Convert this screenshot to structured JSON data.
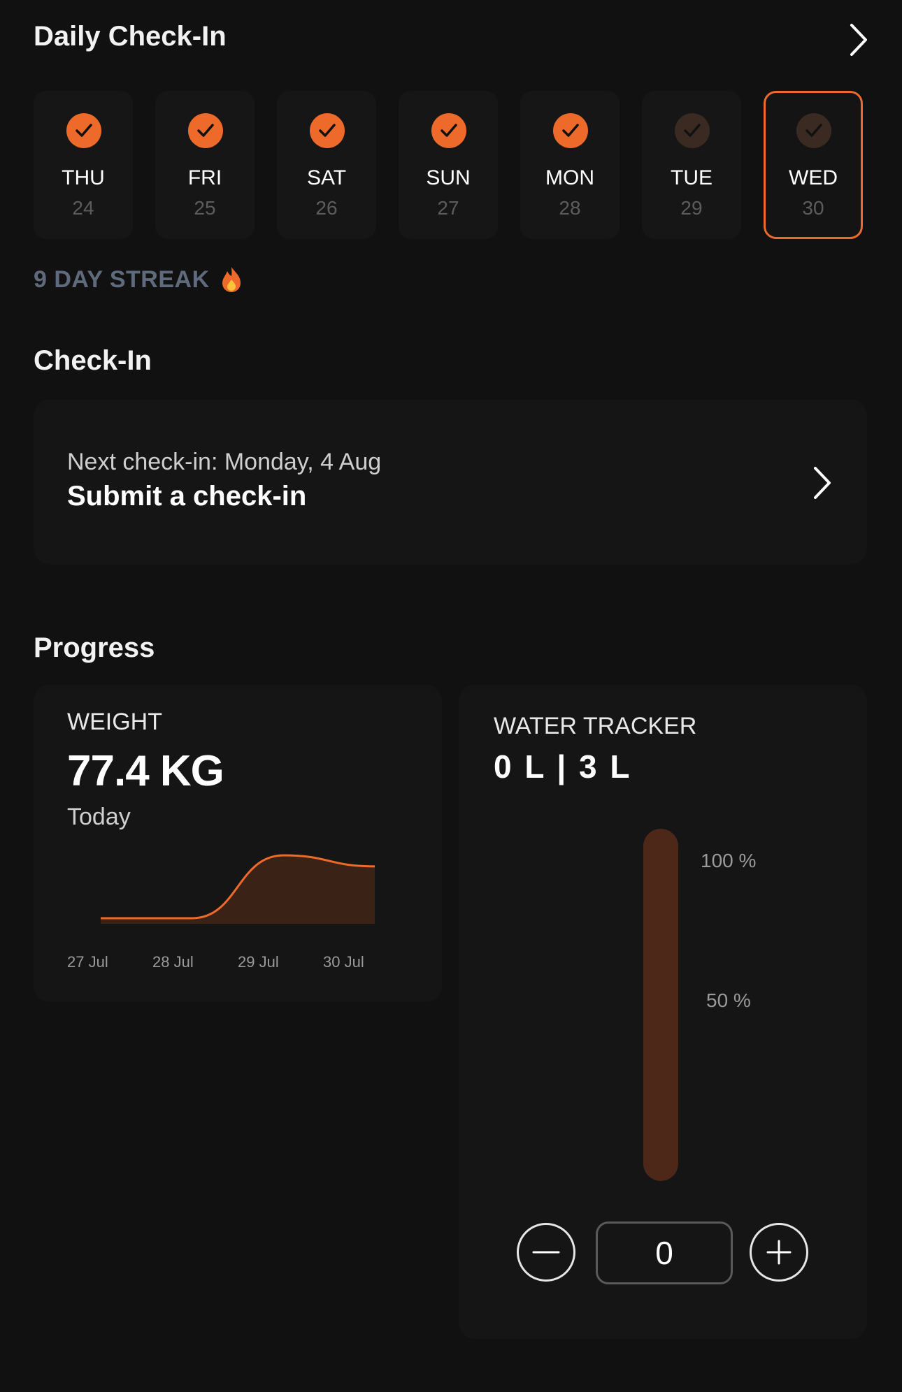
{
  "header": {
    "title": "Daily Check-In",
    "chevron_icon": "chevron-right-icon"
  },
  "days": [
    {
      "name": "THU",
      "num": "24",
      "checked": true
    },
    {
      "name": "FRI",
      "num": "25",
      "checked": true
    },
    {
      "name": "SAT",
      "num": "26",
      "checked": true
    },
    {
      "name": "SUN",
      "num": "27",
      "checked": true
    },
    {
      "name": "MON",
      "num": "28",
      "checked": true
    },
    {
      "name": "TUE",
      "num": "29",
      "checked": false
    },
    {
      "name": "WED",
      "num": "30",
      "checked": false,
      "selected": true
    }
  ],
  "streak": {
    "label": "9 DAY STREAK",
    "icon": "flame-icon"
  },
  "checkin": {
    "section_title": "Check-In",
    "next_label": "Next check-in: Monday, 4 Aug",
    "action_label": "Submit a check-in"
  },
  "progress": {
    "section_title": "Progress",
    "weight": {
      "label": "WEIGHT",
      "value": "77.4 KG",
      "sub": "Today"
    },
    "water": {
      "label": "WATER TRACKER",
      "value": "0 L | 3 L",
      "fill_fraction": 0,
      "pct_100": "100 %",
      "pct_50": "50 %",
      "quantity": "0"
    }
  },
  "chart_data": {
    "type": "area",
    "x": [
      "27 Jul",
      "28 Jul",
      "29 Jul",
      "30 Jul"
    ],
    "series": [
      {
        "values": [
          76.0,
          76.0,
          77.7,
          77.4
        ]
      }
    ],
    "title": "",
    "xlabel": "",
    "ylabel": "",
    "grid": false
  },
  "colors": {
    "accent": "#ee6a2a",
    "background": "#111111",
    "card": "#151515",
    "streak_text": "#5f6b7d",
    "water_track": "#4d2818"
  }
}
